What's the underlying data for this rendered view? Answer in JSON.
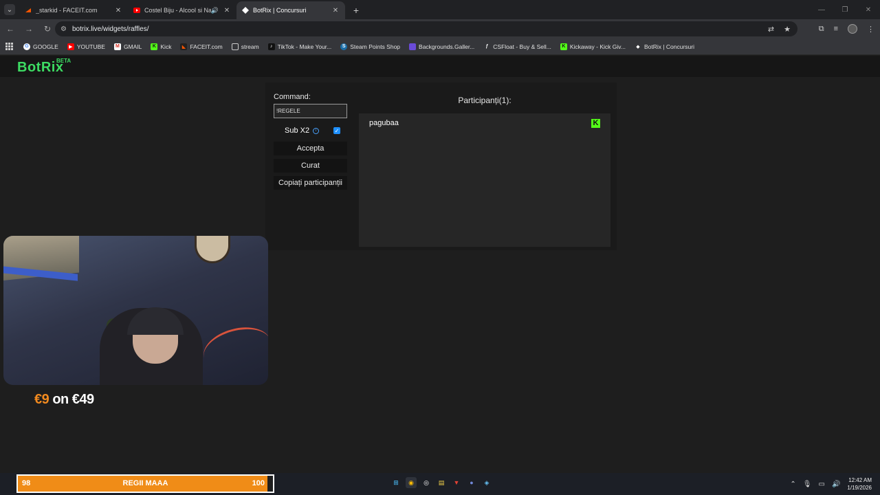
{
  "browser": {
    "tabs": [
      {
        "title": "_starkid - FACEIT.com",
        "active": false
      },
      {
        "title": "Costel Biju - Alcool si Narco",
        "active": false
      },
      {
        "title": "BotRix | Concursuri",
        "active": true
      }
    ],
    "url": "botrix.live/widgets/raffles/",
    "bookmarks": [
      {
        "label": "GOOGLE",
        "icon": "google-icon"
      },
      {
        "label": "YOUTUBE",
        "icon": "youtube-icon"
      },
      {
        "label": "GMAIL",
        "icon": "gmail-icon"
      },
      {
        "label": "Kick",
        "icon": "kick-icon"
      },
      {
        "label": "FACEIT.com",
        "icon": "faceit-icon"
      },
      {
        "label": "stream",
        "icon": "folder-icon"
      },
      {
        "label": "TikTok - Make Your...",
        "icon": "tiktok-icon"
      },
      {
        "label": "Steam Points Shop",
        "icon": "steam-icon"
      },
      {
        "label": "Backgrounds.Galler...",
        "icon": "backgrounds-icon"
      },
      {
        "label": "CSFloat - Buy & Sell...",
        "icon": "csfloat-icon"
      },
      {
        "label": "Kickaway - Kick Giv...",
        "icon": "kickaway-icon"
      },
      {
        "label": "BotRix | Concursuri",
        "icon": "botrix-icon"
      }
    ]
  },
  "site": {
    "logo": "BotRix",
    "badge": "BETA"
  },
  "raffle": {
    "command_label": "Command:",
    "command_value": "!REGELE",
    "sub_label": "Sub X2",
    "sub_checked": true,
    "accept_label": "Accepta",
    "clear_label": "Curat",
    "copy_label": "Copiați participanții",
    "participants_title": "Participanți(1):",
    "participants": [
      {
        "name": "pagubaa",
        "platform": "kick"
      }
    ]
  },
  "overlay": {
    "price_prefix": "€9",
    "price_suffix": "on €49"
  },
  "goal": {
    "current": "98",
    "label": "REGII MAAA",
    "target": "100",
    "progress": 0.98
  },
  "clock": {
    "time": "12:42 AM",
    "date": "1/19/2026"
  },
  "colors": {
    "brand": "#3ddc63",
    "kick": "#53fc18",
    "goal": "#f08c17"
  }
}
